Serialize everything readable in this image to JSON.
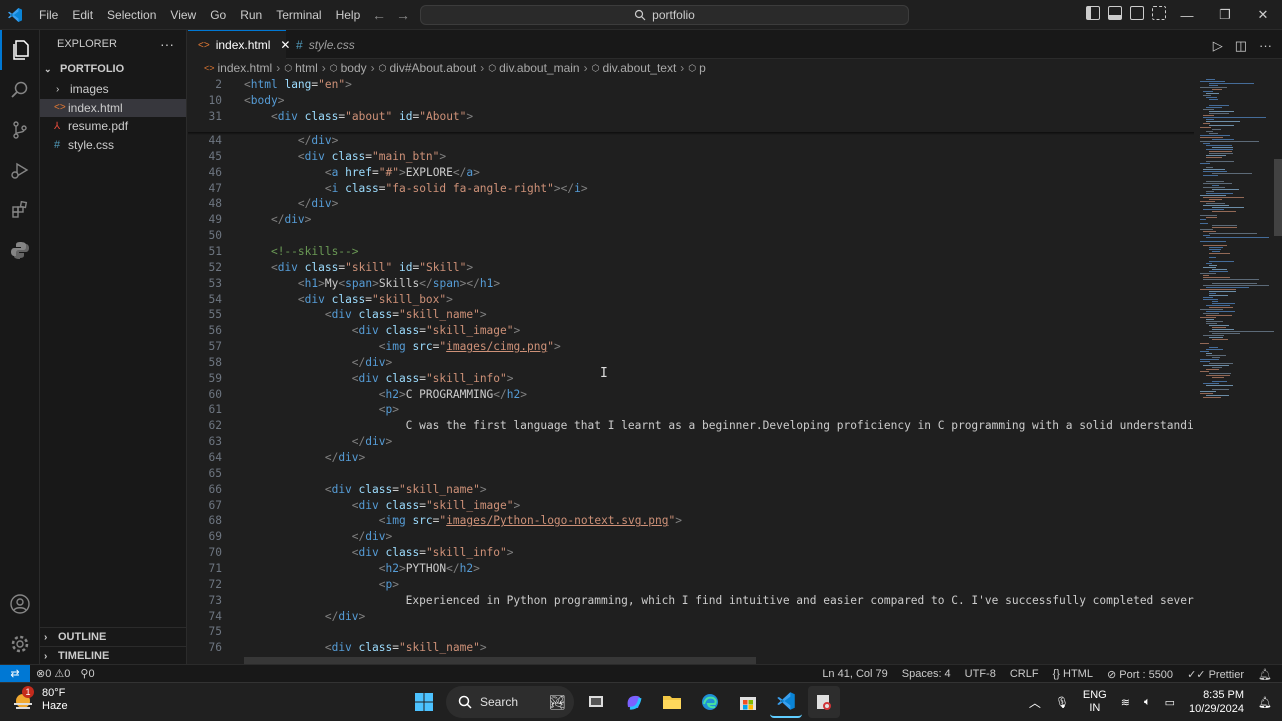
{
  "titlebar": {
    "menu": [
      "File",
      "Edit",
      "Selection",
      "View",
      "Go",
      "Run",
      "Terminal",
      "Help"
    ],
    "search": "portfolio"
  },
  "sidebar": {
    "title": "EXPLORER",
    "folder": "PORTFOLIO",
    "items": [
      {
        "label": "images",
        "kind": "folder"
      },
      {
        "label": "index.html",
        "kind": "html"
      },
      {
        "label": "resume.pdf",
        "kind": "pdf"
      },
      {
        "label": "style.css",
        "kind": "css"
      }
    ],
    "outline": "OUTLINE",
    "timeline": "TIMELINE"
  },
  "tabs": [
    {
      "label": "index.html",
      "active": true
    },
    {
      "label": "style.css",
      "active": false
    }
  ],
  "breadcrumb": [
    "index.html",
    "html",
    "body",
    "div#About.about",
    "div.about_main",
    "div.about_text",
    "p"
  ],
  "sticky_lines": [
    {
      "n": "2",
      "html": "<span class='x'>&lt;</span><span class='t'>html</span> <span class='a'>lang</span>=<span class='s'>\"en\"</span><span class='x'>&gt;</span>"
    },
    {
      "n": "10",
      "html": "<span class='x'>&lt;</span><span class='t'>body</span><span class='x'>&gt;</span>"
    },
    {
      "n": "31",
      "html": "    <span class='x'>&lt;</span><span class='t'>div</span> <span class='a'>class</span>=<span class='s'>\"about\"</span> <span class='a'>id</span>=<span class='s'>\"About\"</span><span class='x'>&gt;</span>"
    }
  ],
  "code_lines": [
    {
      "n": "44",
      "html": "        <span class='x'>&lt;/</span><span class='t'>div</span><span class='x'>&gt;</span>"
    },
    {
      "n": "45",
      "html": "        <span class='x'>&lt;</span><span class='t'>div</span> <span class='a'>class</span>=<span class='s'>\"main_btn\"</span><span class='x'>&gt;</span>"
    },
    {
      "n": "46",
      "html": "            <span class='x'>&lt;</span><span class='t'>a</span> <span class='a'>href</span>=<span class='s'>\"#\"</span><span class='x'>&gt;</span>EXPLORE<span class='x'>&lt;/</span><span class='t'>a</span><span class='x'>&gt;</span>"
    },
    {
      "n": "47",
      "html": "            <span class='x'>&lt;</span><span class='t'>i</span> <span class='a'>class</span>=<span class='s'>\"fa-solid fa-angle-right\"</span><span class='x'>&gt;&lt;/</span><span class='t'>i</span><span class='x'>&gt;</span>"
    },
    {
      "n": "48",
      "html": "        <span class='x'>&lt;/</span><span class='t'>div</span><span class='x'>&gt;</span>"
    },
    {
      "n": "49",
      "html": "    <span class='x'>&lt;/</span><span class='t'>div</span><span class='x'>&gt;</span>"
    },
    {
      "n": "50",
      "html": ""
    },
    {
      "n": "51",
      "html": "    <span class='c'>&lt;!--skills--&gt;</span>"
    },
    {
      "n": "52",
      "html": "    <span class='x'>&lt;</span><span class='t'>div</span> <span class='a'>class</span>=<span class='s'>\"skill\"</span> <span class='a'>id</span>=<span class='s'>\"Skill\"</span><span class='x'>&gt;</span>"
    },
    {
      "n": "53",
      "html": "        <span class='x'>&lt;</span><span class='t'>h1</span><span class='x'>&gt;</span>My<span class='x'>&lt;</span><span class='t'>span</span><span class='x'>&gt;</span>Skills<span class='x'>&lt;/</span><span class='t'>span</span><span class='x'>&gt;&lt;/</span><span class='t'>h1</span><span class='x'>&gt;</span>"
    },
    {
      "n": "54",
      "html": "        <span class='x'>&lt;</span><span class='t'>div</span> <span class='a'>class</span>=<span class='s'>\"skill_box\"</span><span class='x'>&gt;</span>"
    },
    {
      "n": "55",
      "html": "            <span class='x'>&lt;</span><span class='t'>div</span> <span class='a'>class</span>=<span class='s'>\"skill_name\"</span><span class='x'>&gt;</span>"
    },
    {
      "n": "56",
      "html": "                <span class='x'>&lt;</span><span class='t'>div</span> <span class='a'>class</span>=<span class='s'>\"skill_image\"</span><span class='x'>&gt;</span>"
    },
    {
      "n": "57",
      "html": "                    <span class='x'>&lt;</span><span class='t'>img</span> <span class='a'>src</span>=<span class='s'>\"<span class='u'>images/cimg.png</span>\"</span><span class='x'>&gt;</span>"
    },
    {
      "n": "58",
      "html": "                <span class='x'>&lt;/</span><span class='t'>div</span><span class='x'>&gt;</span>"
    },
    {
      "n": "59",
      "html": "                <span class='x'>&lt;</span><span class='t'>div</span> <span class='a'>class</span>=<span class='s'>\"skill_info\"</span><span class='x'>&gt;</span>"
    },
    {
      "n": "60",
      "html": "                    <span class='x'>&lt;</span><span class='t'>h2</span><span class='x'>&gt;</span>C PROGRAMMING<span class='x'>&lt;/</span><span class='t'>h2</span><span class='x'>&gt;</span>"
    },
    {
      "n": "61",
      "html": "                    <span class='x'>&lt;</span><span class='t'>p</span><span class='x'>&gt;</span>"
    },
    {
      "n": "62",
      "html": "                        C was the first language that I learnt as a beginner.Developing proficiency in C programming with a solid understanding of c"
    },
    {
      "n": "63",
      "html": "                <span class='x'>&lt;/</span><span class='t'>div</span><span class='x'>&gt;</span>"
    },
    {
      "n": "64",
      "html": "            <span class='x'>&lt;/</span><span class='t'>div</span><span class='x'>&gt;</span>"
    },
    {
      "n": "65",
      "html": ""
    },
    {
      "n": "66",
      "html": "            <span class='x'>&lt;</span><span class='t'>div</span> <span class='a'>class</span>=<span class='s'>\"skill_name\"</span><span class='x'>&gt;</span>"
    },
    {
      "n": "67",
      "html": "                <span class='x'>&lt;</span><span class='t'>div</span> <span class='a'>class</span>=<span class='s'>\"skill_image\"</span><span class='x'>&gt;</span>"
    },
    {
      "n": "68",
      "html": "                    <span class='x'>&lt;</span><span class='t'>img</span> <span class='a'>src</span>=<span class='s'>\"<span class='u'>images/Python-logo-notext.svg.png</span>\"</span><span class='x'>&gt;</span>"
    },
    {
      "n": "69",
      "html": "                <span class='x'>&lt;/</span><span class='t'>div</span><span class='x'>&gt;</span>"
    },
    {
      "n": "70",
      "html": "                <span class='x'>&lt;</span><span class='t'>div</span> <span class='a'>class</span>=<span class='s'>\"skill_info\"</span><span class='x'>&gt;</span>"
    },
    {
      "n": "71",
      "html": "                    <span class='x'>&lt;</span><span class='t'>h2</span><span class='x'>&gt;</span>PYTHON<span class='x'>&lt;/</span><span class='t'>h2</span><span class='x'>&gt;</span>"
    },
    {
      "n": "72",
      "html": "                    <span class='x'>&lt;</span><span class='t'>p</span><span class='x'>&gt;</span>"
    },
    {
      "n": "73",
      "html": "                        Experienced in Python programming, which I find intuitive and easier compared to C. I've successfully completed several pro"
    },
    {
      "n": "74",
      "html": "            <span class='x'>&lt;/</span><span class='t'>div</span><span class='x'>&gt;</span>"
    },
    {
      "n": "75",
      "html": ""
    },
    {
      "n": "76",
      "html": "            <span class='x'>&lt;</span><span class='t'>div</span> <span class='a'>class</span>=<span class='s'>\"skill_name\"</span><span class='x'>&gt;</span>"
    }
  ],
  "statusbar": {
    "errors": "0",
    "warnings": "0",
    "ports": "0",
    "position": "Ln 41, Col 79",
    "spaces": "Spaces: 4",
    "encoding": "UTF-8",
    "eol": "CRLF",
    "language": "HTML",
    "port": "Port : 5500",
    "prettier": "Prettier"
  },
  "taskbar": {
    "temp": "80°F",
    "weather": "Haze",
    "badge": "1",
    "search": "Search",
    "lang1": "ENG",
    "lang2": "IN",
    "time": "8:35 PM",
    "date": "10/29/2024"
  },
  "colors": {
    "accent": "#0078d4",
    "tag": "#569cd6",
    "attr": "#9cdcfe",
    "string": "#ce9178",
    "comment": "#6a9955"
  }
}
